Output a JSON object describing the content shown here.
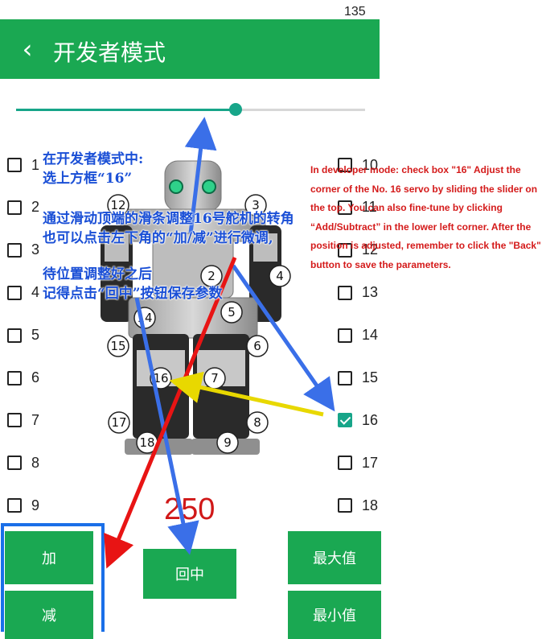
{
  "page_number": "135",
  "appbar": {
    "back_icon": "chevron-left-icon",
    "title": "开发者模式"
  },
  "slider": {
    "level": 0.63
  },
  "servo_list_left": [
    {
      "label": "1",
      "checked": false
    },
    {
      "label": "2",
      "checked": false
    },
    {
      "label": "3",
      "checked": false
    },
    {
      "label": "4",
      "checked": false
    },
    {
      "label": "5",
      "checked": false
    },
    {
      "label": "6",
      "checked": false
    },
    {
      "label": "7",
      "checked": false
    },
    {
      "label": "8",
      "checked": false
    },
    {
      "label": "9",
      "checked": false
    }
  ],
  "servo_list_right": [
    {
      "label": "10",
      "checked": false
    },
    {
      "label": "11",
      "checked": false
    },
    {
      "label": "12",
      "checked": false
    },
    {
      "label": "13",
      "checked": false
    },
    {
      "label": "14",
      "checked": false
    },
    {
      "label": "15",
      "checked": false
    },
    {
      "label": "16",
      "checked": true
    },
    {
      "label": "17",
      "checked": false
    },
    {
      "label": "18",
      "checked": false
    }
  ],
  "robot_servo_labels": [
    "12",
    "3",
    "2",
    "4",
    "14",
    "5",
    "15",
    "6",
    "16",
    "7",
    "17",
    "8",
    "18",
    "9"
  ],
  "value_display": "250",
  "buttons": {
    "add": "加",
    "subtract": "减",
    "center": "回中",
    "max": "最大值",
    "min": "最小值"
  },
  "annotations": {
    "cn_line1": "在开发者模式中:",
    "cn_line2": "选上方框“16”",
    "cn_line3": "通过滑动顶端的滑条调整16号舵机的转角",
    "cn_line4": "也可以点击左下角的“加/减”进行微调,",
    "cn_line5": "待位置调整好之后",
    "cn_line6": "记得点击“回中”按钮保存参数",
    "en_text": "In developer mode: check box \"16\" Adjust the corner of the No. 16 servo by sliding the slider on the top. You can also fine-tune by clicking “Add/Subtract” in the lower left corner. After the position is adjusted, remember to click the \"Back\" button to save the parameters."
  },
  "colors": {
    "primary_green": "#1aa852",
    "accent_teal": "#17a589",
    "value_red": "#d01818",
    "annotation_blue": "#1a4fd6",
    "annotation_red": "#d41a1a",
    "arrow_yellow": "#f0e000"
  }
}
